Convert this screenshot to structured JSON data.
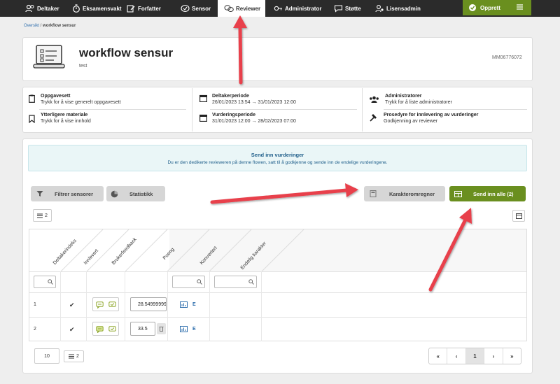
{
  "nav": {
    "items": [
      {
        "label": "Deltaker",
        "icon": "users-icon"
      },
      {
        "label": "Eksamensvakt",
        "icon": "stopwatch-icon"
      },
      {
        "label": "Forfatter",
        "icon": "edit-icon"
      },
      {
        "label": "Sensor",
        "icon": "check-bubble-icon"
      },
      {
        "label": "Reviewer",
        "icon": "review-bubble-icon"
      },
      {
        "label": "Administrator",
        "icon": "key-icon"
      },
      {
        "label": "Støtte",
        "icon": "chat-icon"
      },
      {
        "label": "Lisensadmin",
        "icon": "person-gear-icon"
      }
    ],
    "create_label": "Opprett"
  },
  "breadcrumb": {
    "link": "Oversikt",
    "separator": " / ",
    "current": "workflow sensur"
  },
  "header": {
    "title": "workflow sensur",
    "subtitle": "test",
    "code": "MM06776072"
  },
  "info": {
    "assignment_title": "Oppgavesett",
    "assignment_sub": "Trykk for å vise generelt oppgavesett",
    "material_title": "Ytterligere materiale",
    "material_sub": "Trykk for å vise innhold",
    "participant_title": "Deltakerperiode",
    "participant_sub": "26/01/2023 13:54 → 31/01/2023 12:00",
    "assessment_title": "Vurderingsperiode",
    "assessment_sub": "31/01/2023 12:00 → 28/02/2023 07:00",
    "admins_title": "Administratorer",
    "admins_sub": "Trykk for å liste administratorer",
    "procedure_title": "Prosedyre for innlevering av vurderinger",
    "procedure_sub": "Godkjenning av reviewer"
  },
  "banner": {
    "title": "Send inn vurderinger",
    "text": "Du er den dedikerte revieweren på denne flowen, satt til å godkjenne og sende inn de endelige vurderingene."
  },
  "toolbar": {
    "filter_label": "Filtrer sensorer",
    "stats_label": "Statistikk",
    "converter_label": "Karakteromregner",
    "submit_all_label": "Send inn alle (2)",
    "rows_count": "2"
  },
  "table": {
    "headers": [
      "Deltakerindeks",
      "Innlevert",
      "Brukerfeedback",
      "Poeng",
      "Konvertert",
      "Endelig karakter"
    ],
    "rows": [
      {
        "index": "1",
        "submitted": "✔",
        "score": "28.54999999",
        "converted": "E"
      },
      {
        "index": "2",
        "submitted": "✔",
        "score": "33.5",
        "converted": "E"
      }
    ]
  },
  "footer": {
    "page_size": "10",
    "rows_count": "2"
  },
  "pager": {
    "first": "«",
    "prev": "‹",
    "current": "1",
    "next": "›",
    "last": "»"
  },
  "colors": {
    "brand": "#6a8f1f",
    "annotation": "#e8414b",
    "nav_bg": "#2b2b2b"
  }
}
